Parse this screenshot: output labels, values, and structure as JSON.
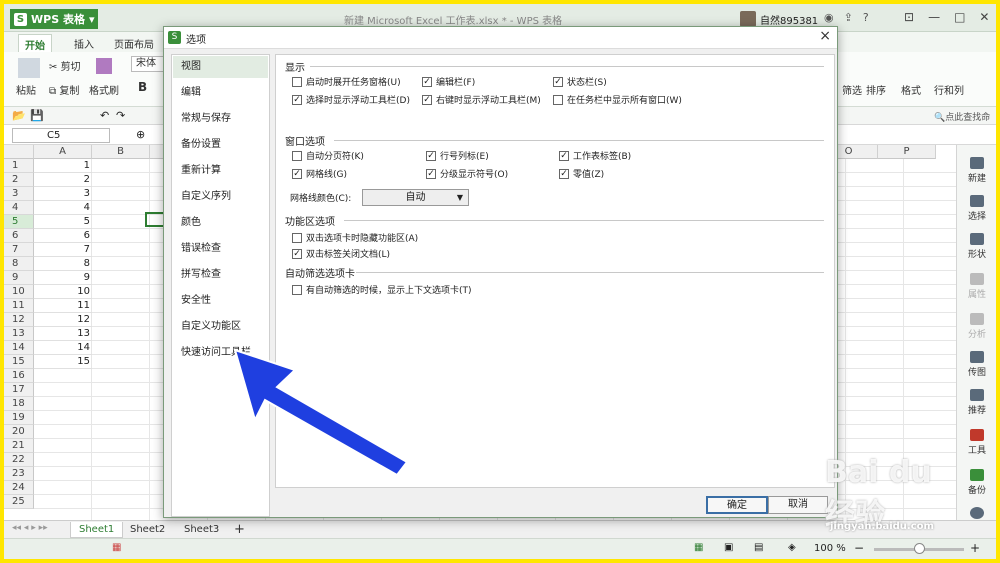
{
  "app": {
    "brand": "WPS 表格",
    "doc_title": "新建 Microsoft Excel 工作表.xlsx * - WPS 表格",
    "user": "自然895381"
  },
  "ribbon_tabs": [
    "开始",
    "插入",
    "页面布局"
  ],
  "ribbon": {
    "paste": "粘贴",
    "cut": "剪切",
    "copy": "复制",
    "format_painter": "格式刷",
    "font": "宋体",
    "bold": "B",
    "filter": "筛选",
    "sort": "排序",
    "format": "格式",
    "rowcol": "行和列"
  },
  "namebox": "C5",
  "search_hint": "点此查找命令",
  "columns": [
    "A",
    "B",
    "O",
    "P"
  ],
  "rows": [
    "1",
    "2",
    "3",
    "4",
    "5",
    "6",
    "7",
    "8",
    "9",
    "10",
    "11",
    "12",
    "13",
    "14",
    "15",
    "16",
    "17",
    "18",
    "19",
    "20",
    "21",
    "22",
    "23",
    "24",
    "25"
  ],
  "col_a_values": [
    "1",
    "2",
    "3",
    "4",
    "5",
    "6",
    "7",
    "8",
    "9",
    "10",
    "11",
    "12",
    "13",
    "14",
    "15"
  ],
  "side_panel": [
    "新建",
    "选择",
    "形状",
    "属性",
    "分析",
    "传图",
    "推荐",
    "工具",
    "备份",
    "帮助"
  ],
  "sheets": [
    "Sheet1",
    "Sheet2",
    "Sheet3"
  ],
  "add_sheet": "+",
  "zoom": "100 %",
  "dialog": {
    "title": "选项",
    "close": "×",
    "nav": [
      "视图",
      "编辑",
      "常规与保存",
      "备份设置",
      "重新计算",
      "自定义序列",
      "颜色",
      "错误检查",
      "拼写检查",
      "安全性",
      "自定义功能区",
      "快速访问工具栏"
    ],
    "sections": {
      "display": "显示",
      "window": "窗口选项",
      "ribbon_area": "功能区选项",
      "autofilter": "自动筛选选项卡"
    },
    "display_opts": [
      {
        "label": "启动时展开任务窗格(U)",
        "checked": false
      },
      {
        "label": "编辑栏(F)",
        "checked": true
      },
      {
        "label": "状态栏(S)",
        "checked": true
      },
      {
        "label": "选择时显示浮动工具栏(D)",
        "checked": true
      },
      {
        "label": "右键时显示浮动工具栏(M)",
        "checked": true
      },
      {
        "label": "在任务栏中显示所有窗口(W)",
        "checked": false
      }
    ],
    "window_opts": [
      {
        "label": "自动分页符(K)",
        "checked": false
      },
      {
        "label": "行号列标(E)",
        "checked": true
      },
      {
        "label": "工作表标签(B)",
        "checked": true
      },
      {
        "label": "网格线(G)",
        "checked": true
      },
      {
        "label": "分级显示符号(O)",
        "checked": true
      },
      {
        "label": "零值(Z)",
        "checked": true
      }
    ],
    "gridline_color_label": "网格线颜色(C):",
    "gridline_color_value": "自动",
    "ribbon_opts": [
      {
        "label": "双击选项卡时隐藏功能区(A)",
        "checked": false
      },
      {
        "label": "双击标签关闭文档(L)",
        "checked": true
      }
    ],
    "autofilter_opts": [
      {
        "label": "有自动筛选的时候，显示上下文选项卡(T)",
        "checked": false
      }
    ],
    "ok": "确定",
    "cancel": "取消"
  },
  "watermark": {
    "brand": "Bai du 经验",
    "url": "jingyan.baidu.com"
  },
  "colors": {
    "accent": "#2e7d32",
    "arrow": "#1f3fe0",
    "frame": "#ffe600"
  }
}
